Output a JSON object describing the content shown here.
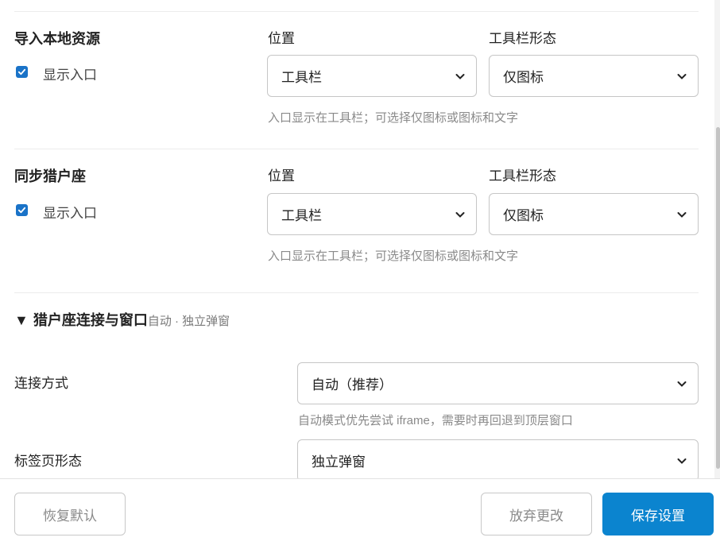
{
  "import_local": {
    "title": "导入本地资源",
    "checkbox_label": "显示入口",
    "checked": true,
    "position_label": "位置",
    "position_value": "工具栏",
    "toolbar_form_label": "工具栏形态",
    "toolbar_form_value": "仅图标",
    "hint": "入口显示在工具栏；可选择仅图标或图标和文字"
  },
  "sync_hunter": {
    "title": "同步猎户座",
    "checkbox_label": "显示入口",
    "checked": true,
    "position_label": "位置",
    "position_value": "工具栏",
    "toolbar_form_label": "工具栏形态",
    "toolbar_form_value": "仅图标",
    "hint": "入口显示在工具栏；可选择仅图标或图标和文字"
  },
  "connection_group": {
    "toggle": "▼",
    "title": "猎户座连接与窗口",
    "subtitle": "自动 · 独立弹窗",
    "connect_label": "连接方式",
    "connect_value": "自动（推荐）",
    "connect_hint": "自动模式优先尝试 iframe，需要时再回退到顶层窗口",
    "tab_form_label": "标签页形态",
    "tab_form_value": "独立弹窗"
  },
  "footer": {
    "reset_label": "恢复默认",
    "discard_label": "放弃更改",
    "save_label": "保存设置"
  },
  "colors": {
    "accent": "#0b84cf",
    "checkbox": "#1a73c8"
  }
}
